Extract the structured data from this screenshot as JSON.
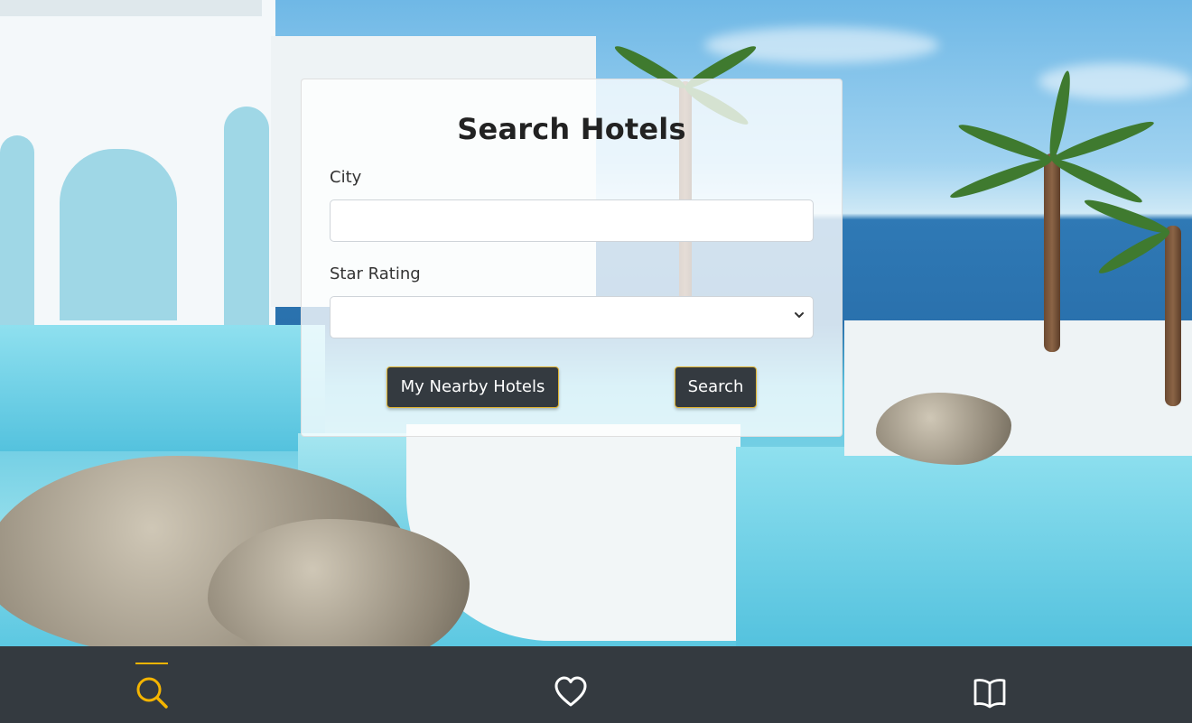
{
  "search_card": {
    "title": "Search Hotels",
    "city_label": "City",
    "city_value": "",
    "star_label": "Star Rating",
    "star_selected": "",
    "nearby_button": "My Nearby Hotels",
    "search_button": "Search"
  },
  "nav": {
    "items": [
      {
        "name": "search",
        "icon": "search-icon",
        "active": true
      },
      {
        "name": "favorites",
        "icon": "heart-icon",
        "active": false
      },
      {
        "name": "bookings",
        "icon": "book-icon",
        "active": false
      }
    ]
  },
  "colors": {
    "accent": "#f4b400",
    "nav_background": "#343a40",
    "button_background": "#343a40",
    "button_border": "#e2b531"
  }
}
